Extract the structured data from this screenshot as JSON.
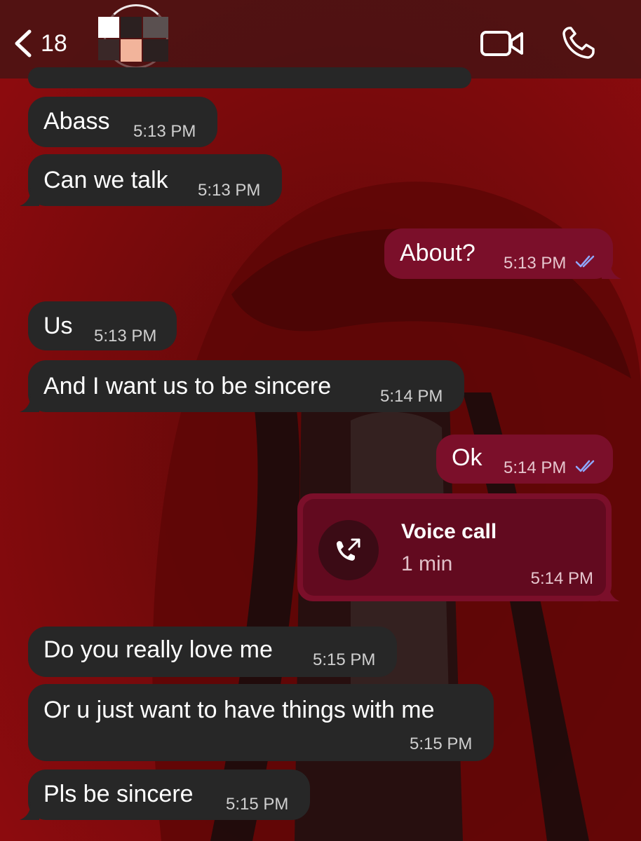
{
  "header": {
    "back_count": "18",
    "icons": {
      "back": "chevron-left-icon",
      "video": "video-camera-icon",
      "call": "phone-icon"
    }
  },
  "messages": [
    {
      "side": "in",
      "text": "Abass",
      "time": "5:13 PM"
    },
    {
      "side": "in",
      "text": "Can we talk",
      "time": "5:13 PM"
    },
    {
      "side": "out",
      "text": "About?",
      "time": "5:13 PM",
      "status": "read"
    },
    {
      "side": "in",
      "text": "Us",
      "time": "5:13 PM"
    },
    {
      "side": "in",
      "text": "And I want us to be sincere",
      "time": "5:14 PM"
    },
    {
      "side": "out",
      "text": "Ok",
      "time": "5:14 PM",
      "status": "read"
    },
    {
      "side": "in",
      "text": "Do you really love me",
      "time": "5:15 PM"
    },
    {
      "side": "in",
      "text": "Or u just want to have things with me",
      "time": "5:15 PM"
    },
    {
      "side": "in",
      "text": "Pls be sincere",
      "time": "5:15 PM"
    }
  ],
  "voice_call": {
    "title": "Voice call",
    "duration": "1 min",
    "time": "5:14 PM",
    "icon": "outgoing-call-icon"
  },
  "colors": {
    "incoming_bubble": "#272727",
    "outgoing_bubble": "#7b0f2a",
    "read_check": "#8fa8ff",
    "wallpaper": "#7a0a0c"
  }
}
